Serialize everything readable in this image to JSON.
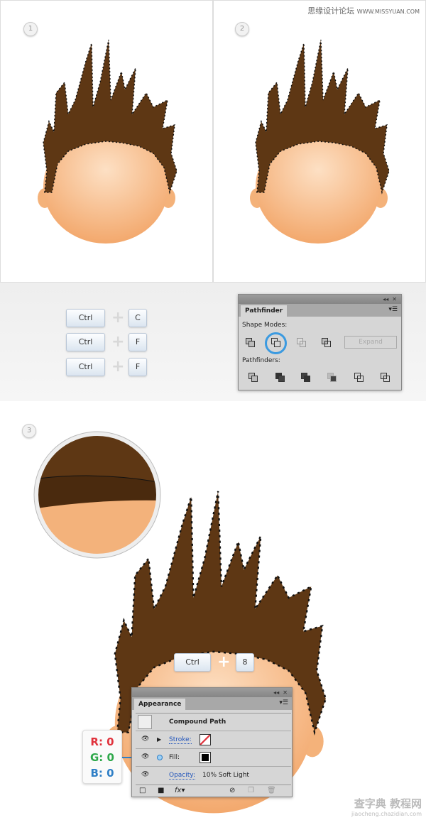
{
  "watermark_top": {
    "cn": "思缘设计论坛",
    "url": "WWW.MISSYUAN.COM"
  },
  "watermark_bottom": {
    "cn": "查字典 教程网",
    "url": "jiaocheng.chazidian.com"
  },
  "steps": [
    "1",
    "2",
    "3"
  ],
  "shortcuts": [
    {
      "mod": "Ctrl",
      "key": "C"
    },
    {
      "mod": "Ctrl",
      "key": "F"
    },
    {
      "mod": "Ctrl",
      "key": "F"
    }
  ],
  "shortcut3": {
    "mod": "Ctrl",
    "key": "8"
  },
  "pathfinder": {
    "tab": "Pathfinder",
    "shape_modes": "Shape Modes:",
    "expand": "Expand",
    "pathfinders": "Pathfinders:",
    "selected_mode": "Minus Front"
  },
  "appearance": {
    "tab": "Appearance",
    "title": "Compound Path",
    "stroke": "Stroke:",
    "fill": "Fill:",
    "opacity": "Opacity:",
    "opacity_value": "10% Soft Light",
    "fill_color": "#000000"
  },
  "rgb": {
    "r": "R: 0",
    "g": "G: 0",
    "b": "B: 0"
  },
  "colors": {
    "hair": "#5e3714",
    "skin": "#f7b880",
    "r": "#e0323c",
    "g": "#2ea84a",
    "b": "#2f7fc6"
  }
}
